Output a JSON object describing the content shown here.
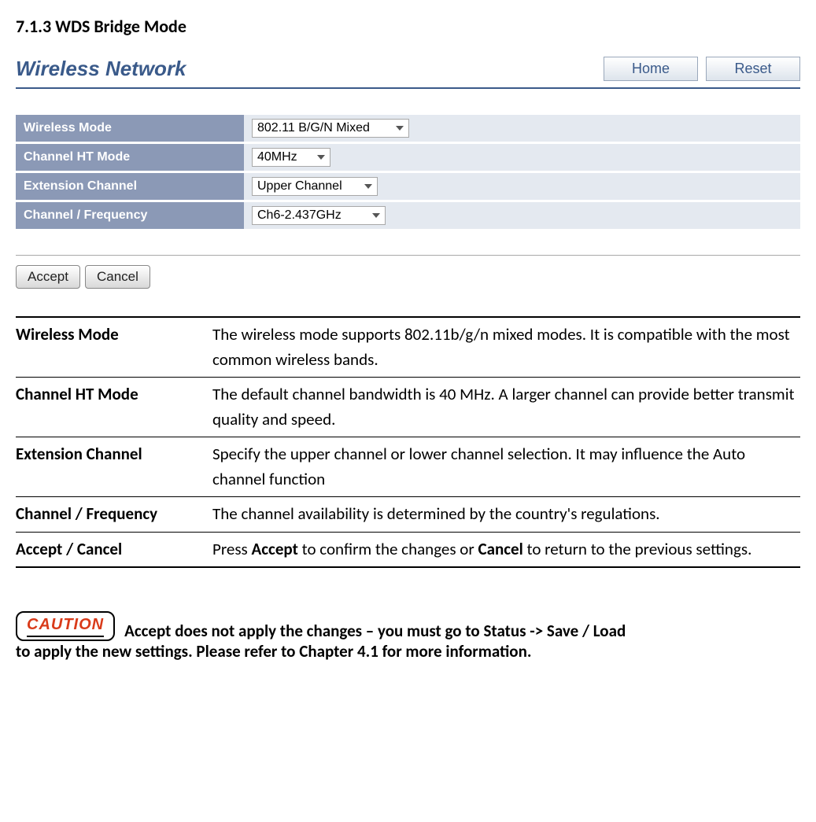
{
  "heading": "7.1.3 WDS Bridge Mode",
  "panel": {
    "title": "Wireless Network",
    "home_label": "Home",
    "reset_label": "Reset"
  },
  "config": {
    "rows": [
      {
        "label": "Wireless Mode",
        "value": "802.11 B/G/N Mixed",
        "class": "dd-wide"
      },
      {
        "label": "Channel HT Mode",
        "value": "40MHz",
        "class": ""
      },
      {
        "label": "Extension Channel",
        "value": "Upper Channel",
        "class": "dd-med"
      },
      {
        "label": "Channel / Frequency",
        "value": "Ch6-2.437GHz",
        "class": "dd-medw"
      }
    ]
  },
  "actions": {
    "accept_label": "Accept",
    "cancel_label": "Cancel"
  },
  "desc": {
    "rows": [
      {
        "label": "Wireless Mode",
        "text": "The wireless mode supports 802.11b/g/n mixed modes. It is compatible with the most common wireless bands."
      },
      {
        "label": "Channel HT Mode",
        "text": "The default channel bandwidth is 40 MHz. A larger channel can provide better transmit quality and speed."
      },
      {
        "label": "Extension Channel",
        "text": "Specify the upper channel or lower channel selection. It may influence the Auto channel function"
      },
      {
        "label": "Channel / Frequency",
        "text": "The channel availability is determined by the country's regulations."
      }
    ],
    "accept_cancel_label": "Accept / Cancel",
    "accept_cancel_pre": "Press ",
    "accept_cancel_b1": "Accept",
    "accept_cancel_mid": " to confirm the changes or ",
    "accept_cancel_b2": "Cancel",
    "accept_cancel_post": " to return to the previous settings."
  },
  "caution": {
    "badge": "CAUTION",
    "line1": "Accept does not apply the changes – you must go to Status -> Save / Load",
    "line2": "to apply the new settings. Please refer to Chapter 4.1 for more information."
  }
}
